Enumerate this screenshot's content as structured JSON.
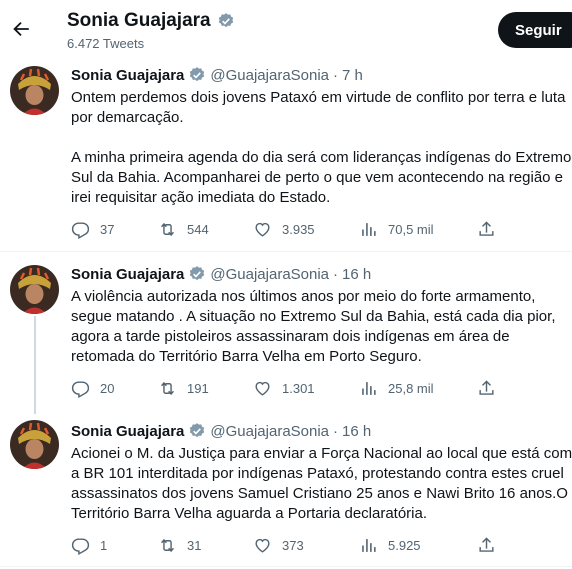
{
  "header": {
    "name": "Sonia Guajajara",
    "tweet_count": "6.472 Tweets",
    "follow_label": "Seguir"
  },
  "colors": {
    "verified": "#829aab",
    "text": "#0f1419",
    "muted": "#536471"
  },
  "tweets": [
    {
      "name": "Sonia Guajajara",
      "handle": "@GuajajaraSonia",
      "sep": "·",
      "time": "7 h",
      "text": "Ontem perdemos dois jovens Pataxó em virtude de conflito por terra e luta por demarcação.\n\nA minha primeira agenda do dia será com lideranças indígenas do Extremo Sul da Bahia. Acompanharei de perto o que vem acontecendo na região e irei requisitar ação imediata do Estado.",
      "replies": "37",
      "retweets": "544",
      "likes": "3.935",
      "views": "70,5 mil"
    },
    {
      "name": "Sonia Guajajara",
      "handle": "@GuajajaraSonia",
      "sep": "·",
      "time": "16 h",
      "text": "A violência autorizada nos últimos anos  por meio do forte armamento, segue matando . A situação no Extremo Sul da Bahia, está cada dia pior, agora a tarde pistoleiros assassinaram dois indígenas em área de retomada do Território Barra Velha em Porto Seguro.",
      "replies": "20",
      "retweets": "191",
      "likes": "1.301",
      "views": "25,8 mil"
    },
    {
      "name": "Sonia Guajajara",
      "handle": "@GuajajaraSonia",
      "sep": "·",
      "time": "16 h",
      "text": "Acionei o M. da Justiça  para enviar a Força Nacional ao local que está com a BR 101 interditada por  indígenas Pataxó, protestando contra estes cruel assassinatos dos jovens Samuel Cristiano 25 anos e  Nawi Brito 16 anos.O Território Barra Velha aguarda a Portaria declaratória.",
      "replies": "1",
      "retweets": "31",
      "likes": "373",
      "views": "5.925"
    }
  ]
}
